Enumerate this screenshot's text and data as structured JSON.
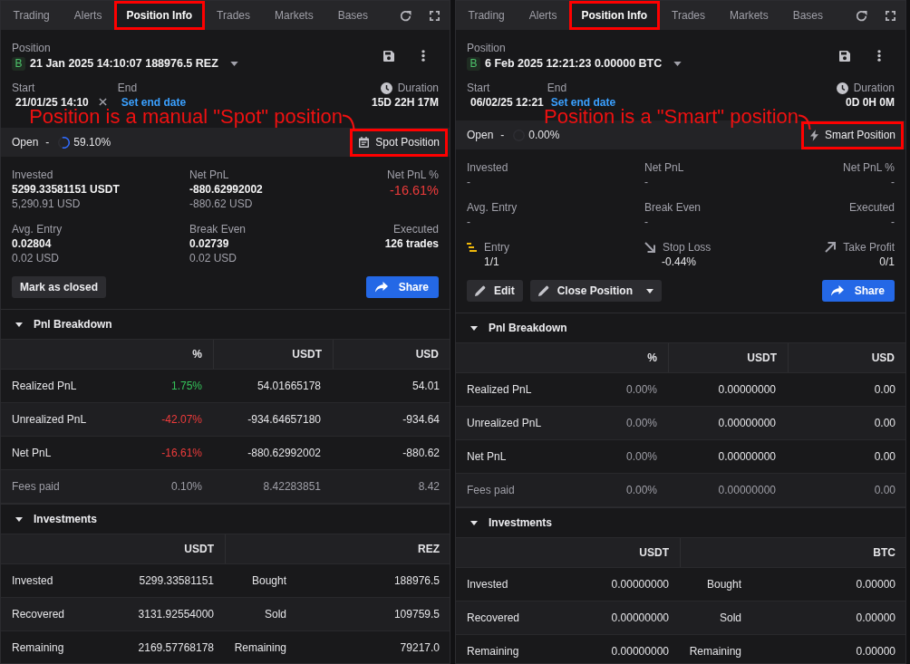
{
  "panels": [
    {
      "tabs": [
        {
          "label": "Trading",
          "selected": false,
          "highlighted": false
        },
        {
          "label": "Alerts",
          "selected": false,
          "highlighted": false
        },
        {
          "label": "Position Info",
          "selected": true,
          "highlighted": true
        },
        {
          "label": "Trades",
          "selected": false,
          "highlighted": false
        },
        {
          "label": "Markets",
          "selected": false,
          "highlighted": false
        },
        {
          "label": "Bases",
          "selected": false,
          "highlighted": false
        }
      ],
      "position": {
        "label": "Position",
        "side": "B",
        "title": "21 Jan 2025 14:10:07 188976.5 REZ"
      },
      "start": {
        "label": "Start",
        "value": "21/01/25 14:10",
        "clearable": true
      },
      "end": {
        "label": "End",
        "link": "Set end date"
      },
      "duration": {
        "label": "Duration",
        "value": "15D 22H 17M"
      },
      "annotation": {
        "text": "Position is a manual \"Spot\" position"
      },
      "status": {
        "label": "Open",
        "separator": "-",
        "level": 0.591,
        "value": "59.10%"
      },
      "position_type": {
        "kind": "spot",
        "label": "Spot Position",
        "highlighted": true
      },
      "stats": [
        {
          "label": "Invested",
          "value": "5299.33581151 USDT",
          "sub": "5,290.91 USD",
          "kind": "amount"
        },
        {
          "label": "Net PnL",
          "value": "-880.62992002",
          "sub": "-880.62 USD",
          "kind": "amount"
        },
        {
          "label": "Net PnL %",
          "value": "-16.61%",
          "kind": "change",
          "color": "#ee3b3b"
        },
        {
          "label": "Avg. Entry",
          "value": "0.02804",
          "sub": "0.02 USD",
          "kind": "amount"
        },
        {
          "label": "Break Even",
          "value": "0.02739",
          "sub": "0.02 USD",
          "kind": "amount"
        },
        {
          "label": "Executed",
          "value": "126 trades",
          "kind": "amount"
        }
      ],
      "actions": [
        {
          "kind": "mark-closed",
          "label": "Mark as closed"
        },
        {
          "kind": "share",
          "label": "Share"
        }
      ],
      "pnl_breakdown": {
        "title": "Pnl Breakdown",
        "expanded": true,
        "columns": [
          "%",
          "USDT",
          "USD"
        ],
        "rows": [
          {
            "label": "Realized PnL",
            "percent": "1.75%",
            "color": "#35c35a",
            "usdt": "54.01665178",
            "usd": "54.01",
            "muted": false
          },
          {
            "label": "Unrealized PnL",
            "percent": "-42.07%",
            "color": "#ee3b3b",
            "usdt": "-934.64657180",
            "usd": "-934.64",
            "muted": false
          },
          {
            "label": "Net PnL",
            "percent": "-16.61%",
            "color": "#ee3b3b",
            "usdt": "-880.62992002",
            "usd": "-880.62",
            "muted": false
          },
          {
            "label": "Fees paid",
            "percent": "0.10%",
            "color": "#9f9fa7",
            "usdt": "8.42283851",
            "usd": "8.42",
            "muted": true
          }
        ]
      },
      "investments": {
        "title": "Investments",
        "expanded": true,
        "columns": [
          "USDT",
          "REZ"
        ],
        "rows": [
          {
            "label": "Invested",
            "value": "5299.33581151",
            "asset_label": "Bought",
            "asset_value": "188976.5"
          },
          {
            "label": "Recovered",
            "value": "3131.92554000",
            "asset_label": "Sold",
            "asset_value": "109759.5"
          },
          {
            "label": "Remaining",
            "value": "2169.57768178",
            "asset_label": "Remaining",
            "asset_value": "79217.0"
          }
        ]
      }
    },
    {
      "tabs": [
        {
          "label": "Trading",
          "selected": false,
          "highlighted": false
        },
        {
          "label": "Alerts",
          "selected": false,
          "highlighted": false
        },
        {
          "label": "Position Info",
          "selected": true,
          "highlighted": true
        },
        {
          "label": "Trades",
          "selected": false,
          "highlighted": false
        },
        {
          "label": "Markets",
          "selected": false,
          "highlighted": false
        },
        {
          "label": "Bases",
          "selected": false,
          "highlighted": false
        }
      ],
      "position": {
        "label": "Position",
        "side": "B",
        "title": "6 Feb 2025 12:21:23 0.00000 BTC"
      },
      "start": {
        "label": "Start",
        "value": "06/02/25 12:21",
        "clearable": false
      },
      "end": {
        "label": "End",
        "link": "Set end date"
      },
      "duration": {
        "label": "Duration",
        "value": "0D 0H 0M"
      },
      "annotation": {
        "text": "Position is a \"Smart\" position"
      },
      "status": {
        "label": "Open",
        "separator": "-",
        "level": 0,
        "value": "0.00%"
      },
      "position_type": {
        "kind": "smart",
        "label": "Smart Position",
        "highlighted": true
      },
      "stats": [
        {
          "label": "Invested",
          "value": "-",
          "kind": "empty"
        },
        {
          "label": "Net PnL",
          "value": "-",
          "kind": "empty"
        },
        {
          "label": "Net PnL %",
          "value": "-",
          "kind": "empty"
        },
        {
          "label": "Avg. Entry",
          "value": "-",
          "kind": "empty"
        },
        {
          "label": "Break Even",
          "value": "-",
          "kind": "empty"
        },
        {
          "label": "Executed",
          "value": "-",
          "kind": "empty"
        }
      ],
      "targets": [
        {
          "kind": "entry",
          "label": "Entry",
          "value": "1/1"
        },
        {
          "kind": "stop-loss",
          "label": "Stop Loss",
          "value": "-0.44%"
        },
        {
          "kind": "take-profit",
          "label": "Take Profit",
          "value": "0/1"
        }
      ],
      "actions": [
        {
          "kind": "edit",
          "label": "Edit"
        },
        {
          "kind": "close",
          "label": "Close Position"
        },
        {
          "kind": "share",
          "label": "Share"
        }
      ],
      "pnl_breakdown": {
        "title": "Pnl Breakdown",
        "expanded": true,
        "columns": [
          "%",
          "USDT",
          "USD"
        ],
        "rows": [
          {
            "label": "Realized PnL",
            "percent": "0.00%",
            "color": "#9f9fa7",
            "usdt": "0.00000000",
            "usd": "0.00",
            "muted": false
          },
          {
            "label": "Unrealized PnL",
            "percent": "0.00%",
            "color": "#9f9fa7",
            "usdt": "0.00000000",
            "usd": "0.00",
            "muted": false
          },
          {
            "label": "Net PnL",
            "percent": "0.00%",
            "color": "#9f9fa7",
            "usdt": "0.00000000",
            "usd": "0.00",
            "muted": false
          },
          {
            "label": "Fees paid",
            "percent": "0.00%",
            "color": "#9f9fa7",
            "usdt": "0.00000000",
            "usd": "0.00",
            "muted": true
          }
        ]
      },
      "investments": {
        "title": "Investments",
        "expanded": true,
        "columns": [
          "USDT",
          "BTC"
        ],
        "rows": [
          {
            "label": "Invested",
            "value": "0.00000000",
            "asset_label": "Bought",
            "asset_value": "0.00000"
          },
          {
            "label": "Recovered",
            "value": "0.00000000",
            "asset_label": "Sold",
            "asset_value": "0.00000"
          },
          {
            "label": "Remaining",
            "value": "0.00000000",
            "asset_label": "Remaining",
            "asset_value": "0.00000"
          }
        ]
      }
    }
  ]
}
